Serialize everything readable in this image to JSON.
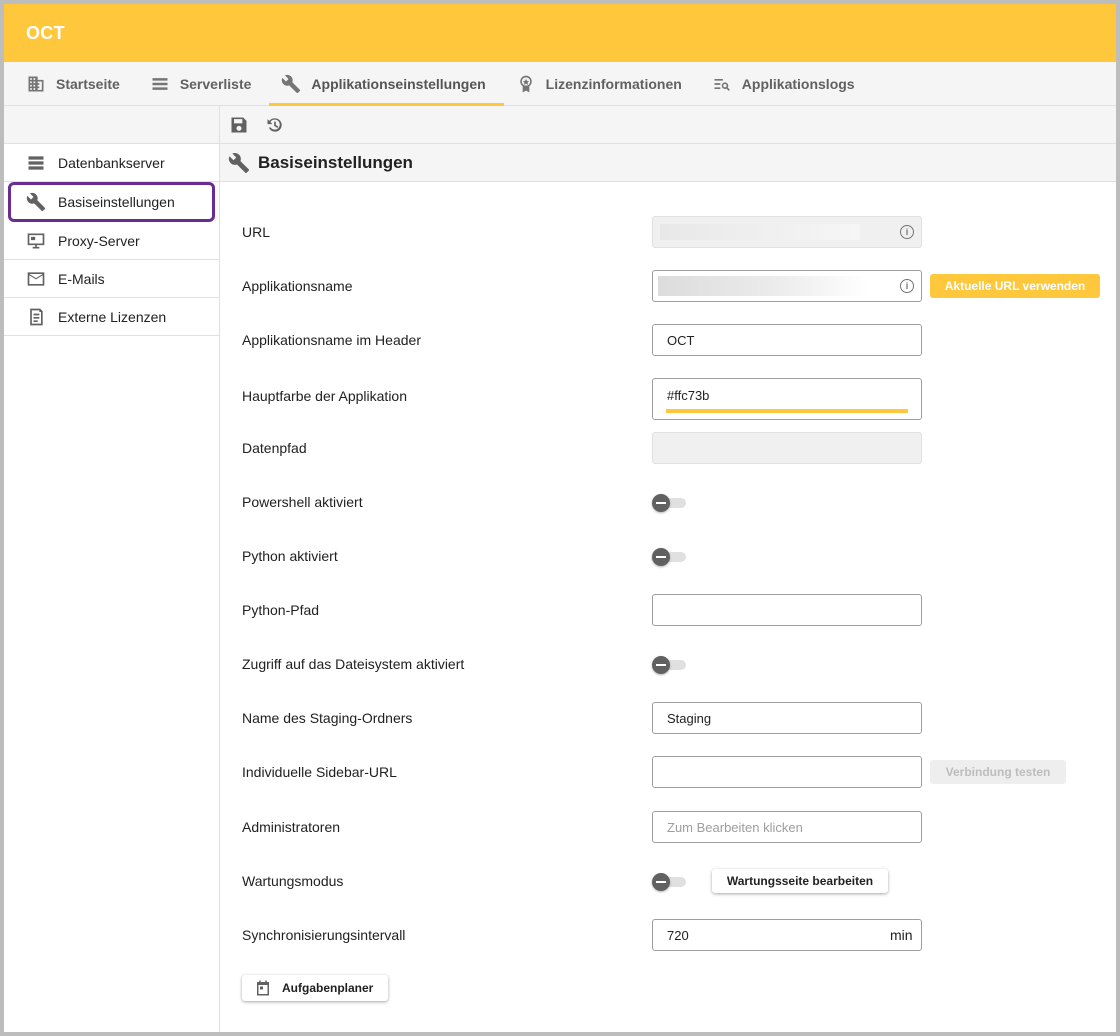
{
  "app": {
    "title": "OCT",
    "accent": "#ffc73b",
    "selection_outline": "#6a2c91"
  },
  "nav": {
    "tabs": [
      {
        "label": "Startseite",
        "icon": "building-icon"
      },
      {
        "label": "Serverliste",
        "icon": "list-icon"
      },
      {
        "label": "Applikationseinstellungen",
        "icon": "wrench-icon",
        "active": true
      },
      {
        "label": "Lizenzinformationen",
        "icon": "award-icon"
      },
      {
        "label": "Applikationslogs",
        "icon": "log-search-icon"
      }
    ]
  },
  "sidebar": {
    "items": [
      {
        "label": "Datenbankserver",
        "icon": "database-icon"
      },
      {
        "label": "Basiseinstellungen",
        "icon": "wrench-icon",
        "selected": true
      },
      {
        "label": "Proxy-Server",
        "icon": "monitor-icon"
      },
      {
        "label": "E-Mails",
        "icon": "mail-icon"
      },
      {
        "label": "Externe Lizenzen",
        "icon": "license-icon"
      }
    ]
  },
  "toolbar": {
    "save_icon": "save-icon",
    "reset_icon": "reset-icon"
  },
  "section": {
    "title": "Basiseinstellungen"
  },
  "form": {
    "url": {
      "label": "URL"
    },
    "app_name": {
      "label": "Applikationsname",
      "button": "Aktuelle URL verwenden"
    },
    "header_name": {
      "label": "Applikationsname im Header",
      "value": "OCT"
    },
    "main_color": {
      "label": "Hauptfarbe der Applikation",
      "value": "#ffc73b"
    },
    "data_path": {
      "label": "Datenpfad",
      "value": ""
    },
    "powershell": {
      "label": "Powershell aktiviert",
      "enabled": false
    },
    "python": {
      "label": "Python aktiviert",
      "enabled": false
    },
    "python_path": {
      "label": "Python-Pfad",
      "value": ""
    },
    "filesystem": {
      "label": "Zugriff auf das Dateisystem aktiviert",
      "enabled": false
    },
    "staging": {
      "label": "Name des Staging-Ordners",
      "value": "Staging"
    },
    "sidebar_url": {
      "label": "Individuelle Sidebar-URL",
      "value": "",
      "button": "Verbindung testen"
    },
    "admins": {
      "label": "Administratoren",
      "placeholder": "Zum Bearbeiten klicken"
    },
    "maintenance": {
      "label": "Wartungsmodus",
      "enabled": false,
      "button": "Wartungsseite bearbeiten"
    },
    "sync": {
      "label": "Synchronisierungsintervall",
      "value": "720",
      "unit": "min"
    },
    "scheduler": {
      "button": "Aufgabenplaner"
    }
  }
}
